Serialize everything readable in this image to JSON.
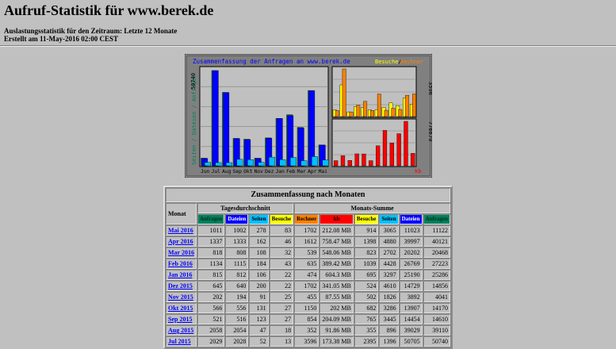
{
  "page": {
    "title": "Aufruf-Statistik für www.berek.de",
    "period": "Auslastungsstatistik für den Zeitraum: Letzte 12 Monate",
    "created": "Erstellt am 11-May-2016 02:00 CEST"
  },
  "graph": {
    "title": "Zusammenfassung der Anfragen an www.berek.de",
    "legend_left": "Seiten / Dateien / Anfragen",
    "legend_visits": "Besuche",
    "legend_sep": " / ",
    "legend_hosts": "Rechner",
    "ymax_left": "50740",
    "ymax_right_top": "3596",
    "ymax_right_bottom": "776670",
    "kb_label": "kb",
    "colors": {
      "hits": "#00805c",
      "files": "#0000ff",
      "pages": "#00c0ff",
      "visits": "#ffff00",
      "hosts": "#ff8000",
      "kbytes": "#ff0000"
    }
  },
  "chart_data": {
    "type": "bar",
    "categories": [
      "Jun",
      "Jul",
      "Aug",
      "Sep",
      "Okt",
      "Nov",
      "Dez",
      "Jan",
      "Feb",
      "Mar",
      "Apr",
      "Mai"
    ],
    "series": [
      {
        "name": "Anfragen",
        "values": [
          4041,
          50740,
          39110,
          14610,
          14170,
          4041,
          14856,
          25286,
          27223,
          20468,
          40121,
          11122
        ]
      },
      {
        "name": "Dateien",
        "values": [
          3892,
          50705,
          39029,
          14454,
          13907,
          3892,
          14729,
          25190,
          26769,
          20202,
          39997,
          11023
        ]
      },
      {
        "name": "Seiten",
        "values": [
          1826,
          1396,
          896,
          3445,
          3286,
          1826,
          4610,
          3297,
          4428,
          2702,
          4880,
          3065
        ]
      },
      {
        "name": "Besuche",
        "values": [
          502,
          2395,
          355,
          765,
          682,
          502,
          524,
          695,
          1039,
          823,
          1398,
          914
        ]
      },
      {
        "name": "Rechner",
        "values": [
          455,
          3596,
          352,
          854,
          1150,
          455,
          1702,
          474,
          635,
          539,
          1612,
          1702
        ]
      },
      {
        "name": "kb",
        "values": [
          89600,
          177510,
          94060,
          208930,
          206850,
          89600,
          349220,
          618600,
          398660,
          561200,
          776670,
          217210
        ]
      }
    ]
  },
  "table": {
    "title": "Zusammenfassung nach Monaten",
    "monat_header": "Monat",
    "daily_header": "Tagesdurchschnitt",
    "monthly_header": "Monats-Summe",
    "daily_cols": [
      {
        "label": "Anfragen",
        "color": "#00805c"
      },
      {
        "label": "Dateien",
        "color": "#0000ff"
      },
      {
        "label": "Seiten",
        "color": "#00c0ff"
      },
      {
        "label": "Besuche",
        "color": "#ffff00"
      }
    ],
    "monthly_cols": [
      {
        "label": "Rechner",
        "color": "#ff8000"
      },
      {
        "label": "kb",
        "color": "#ff0000"
      },
      {
        "label": "Besuche",
        "color": "#ffff00"
      },
      {
        "label": "Seiten",
        "color": "#00c0ff"
      },
      {
        "label": "Dateien",
        "color": "#0000ff"
      },
      {
        "label": "Anfragen",
        "color": "#00805c"
      }
    ],
    "rows": [
      {
        "month": "Mai 2016",
        "v": [
          "1011",
          "1002",
          "278",
          "83",
          "1702",
          "212.08 MB",
          "914",
          "3065",
          "11023",
          "11122"
        ]
      },
      {
        "month": "Apr 2016",
        "v": [
          "1337",
          "1333",
          "162",
          "46",
          "1612",
          "758.47 MB",
          "1398",
          "4880",
          "39997",
          "40121"
        ]
      },
      {
        "month": "Mar 2016",
        "v": [
          "818",
          "808",
          "108",
          "32",
          "539",
          "548.06 MB",
          "823",
          "2702",
          "20202",
          "20468"
        ]
      },
      {
        "month": "Feb 2016",
        "v": [
          "1134",
          "1115",
          "184",
          "43",
          "635",
          "389.42 MB",
          "1039",
          "4428",
          "26769",
          "27223"
        ]
      },
      {
        "month": "Jan 2016",
        "v": [
          "815",
          "812",
          "106",
          "22",
          "474",
          "604.3 MB",
          "695",
          "3297",
          "25190",
          "25286"
        ]
      },
      {
        "month": "Dez 2015",
        "v": [
          "645",
          "640",
          "200",
          "22",
          "1702",
          "341.05 MB",
          "524",
          "4610",
          "14729",
          "14856"
        ]
      },
      {
        "month": "Nov 2015",
        "v": [
          "202",
          "194",
          "91",
          "25",
          "455",
          "87.55 MB",
          "502",
          "1826",
          "3892",
          "4041"
        ]
      },
      {
        "month": "Okt 2015",
        "v": [
          "566",
          "556",
          "131",
          "27",
          "1150",
          "202 MB",
          "682",
          "3286",
          "13907",
          "14170"
        ]
      },
      {
        "month": "Sep 2015",
        "v": [
          "521",
          "516",
          "123",
          "27",
          "854",
          "204.09 MB",
          "765",
          "3445",
          "14454",
          "14610"
        ]
      },
      {
        "month": "Aug 2015",
        "v": [
          "2058",
          "2054",
          "47",
          "18",
          "352",
          "91.86 MB",
          "355",
          "896",
          "39029",
          "39110"
        ]
      },
      {
        "month": "Jul 2015",
        "v": [
          "2029",
          "2028",
          "52",
          "13",
          "3596",
          "173.38 MB",
          "2395",
          "1396",
          "50705",
          "50740"
        ]
      }
    ]
  }
}
